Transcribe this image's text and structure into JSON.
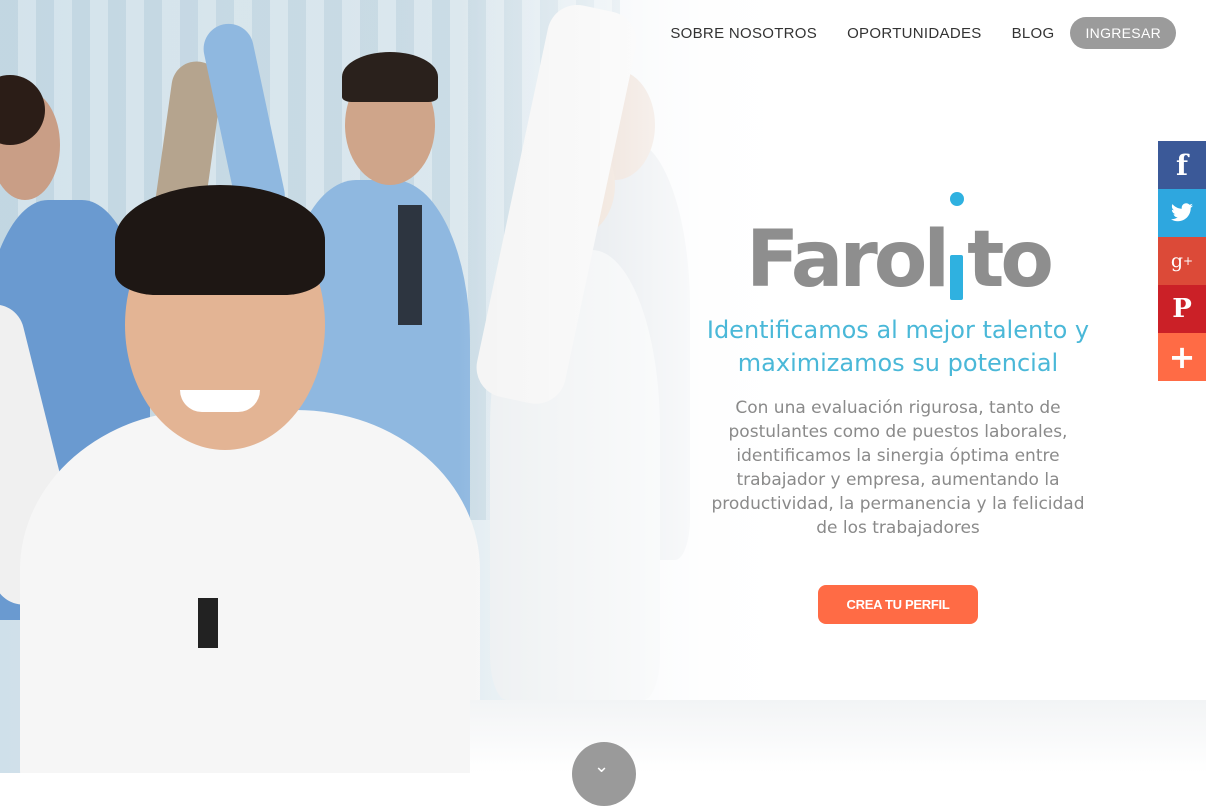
{
  "nav": {
    "about": "SOBRE NOSOTROS",
    "opportunities": "OPORTUNIDADES",
    "blog": "BLOG",
    "login": "INGRESAR"
  },
  "social": [
    {
      "icon": "facebook-icon",
      "glyph": "f",
      "color": "#3b5998"
    },
    {
      "icon": "twitter-icon",
      "glyph": "🐦",
      "color": "#2ea7df"
    },
    {
      "icon": "google-plus-icon",
      "glyph": "g+",
      "color": "#dc4a38"
    },
    {
      "icon": "pinterest-icon",
      "glyph": "P",
      "color": "#cb2027"
    },
    {
      "icon": "share-plus-icon",
      "glyph": "+",
      "color": "#ff6b45"
    }
  ],
  "hero": {
    "logo_prefix": "Farol",
    "logo_suffix": "to",
    "tagline": "Identificamos al mejor talento y maximizamos su potencial",
    "description": "Con una evaluación rigurosa, tanto de postulantes como de puestos laborales, identificamos la sinergia óptima entre trabajador y empresa, aumentando la productividad, la permanencia y la felicidad de los trabajadores",
    "cta": "CREA TU PERFIL"
  },
  "colors": {
    "accent": "#ff6b45",
    "brand_blue": "#2fb1e0",
    "logo_gray": "#8e8e8e"
  }
}
